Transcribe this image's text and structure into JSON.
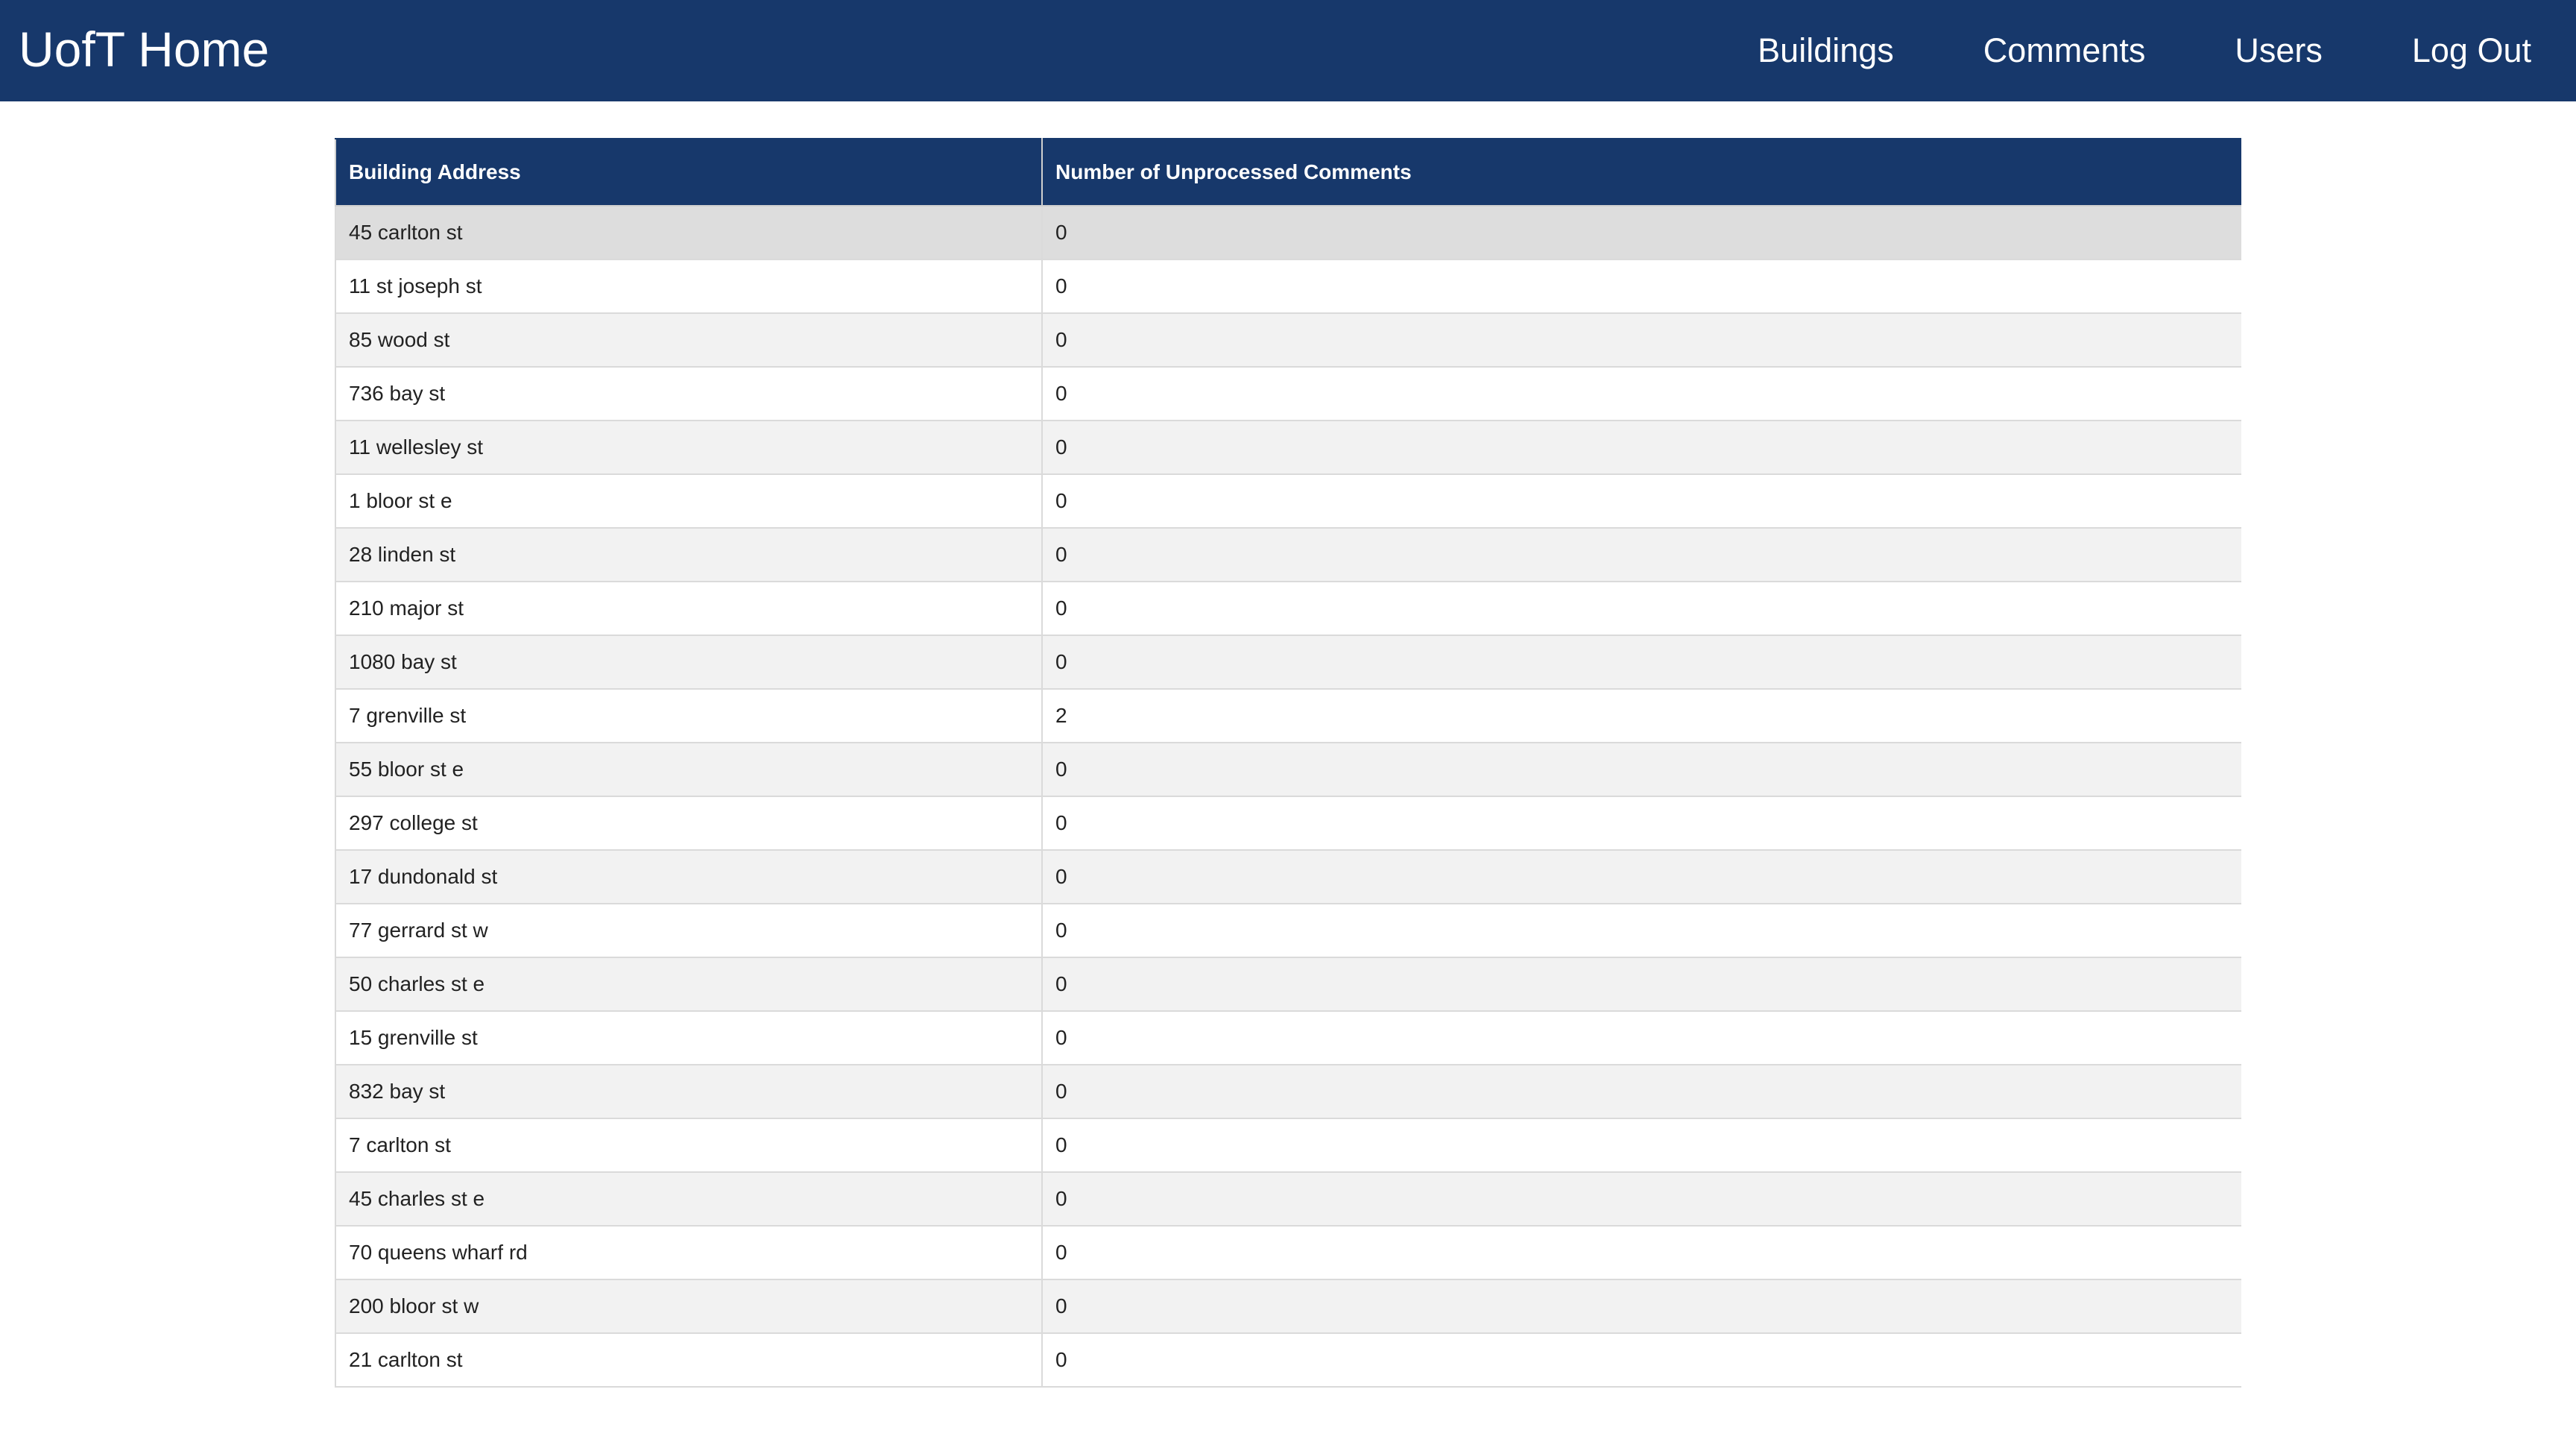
{
  "navbar": {
    "brand": "UofT Home",
    "links": [
      "Buildings",
      "Comments",
      "Users",
      "Log Out"
    ],
    "background": "#17386b"
  },
  "table": {
    "headers": [
      "Building Address",
      "Number of Unprocessed Comments"
    ],
    "rows": [
      [
        "45 carlton st",
        "0"
      ],
      [
        "11 st joseph st",
        "0"
      ],
      [
        "85 wood st",
        "0"
      ],
      [
        "736 bay st",
        "0"
      ],
      [
        "11 wellesley st",
        "0"
      ],
      [
        "1 bloor st e",
        "0"
      ],
      [
        "28 linden st",
        "0"
      ],
      [
        "210 major st",
        "0"
      ],
      [
        "1080 bay st",
        "0"
      ],
      [
        "7 grenville st",
        "2"
      ],
      [
        "55 bloor st e",
        "0"
      ],
      [
        "297 college st",
        "0"
      ],
      [
        "17 dundonald st",
        "0"
      ],
      [
        "77 gerrard st w",
        "0"
      ],
      [
        "50 charles st e",
        "0"
      ],
      [
        "15 grenville st",
        "0"
      ],
      [
        "832 bay st",
        "0"
      ],
      [
        "7 carlton st",
        "0"
      ],
      [
        "45 charles st e",
        "0"
      ],
      [
        "70 queens wharf rd",
        "0"
      ],
      [
        "200 bloor st w",
        "0"
      ],
      [
        "21 carlton st",
        "0"
      ]
    ]
  }
}
